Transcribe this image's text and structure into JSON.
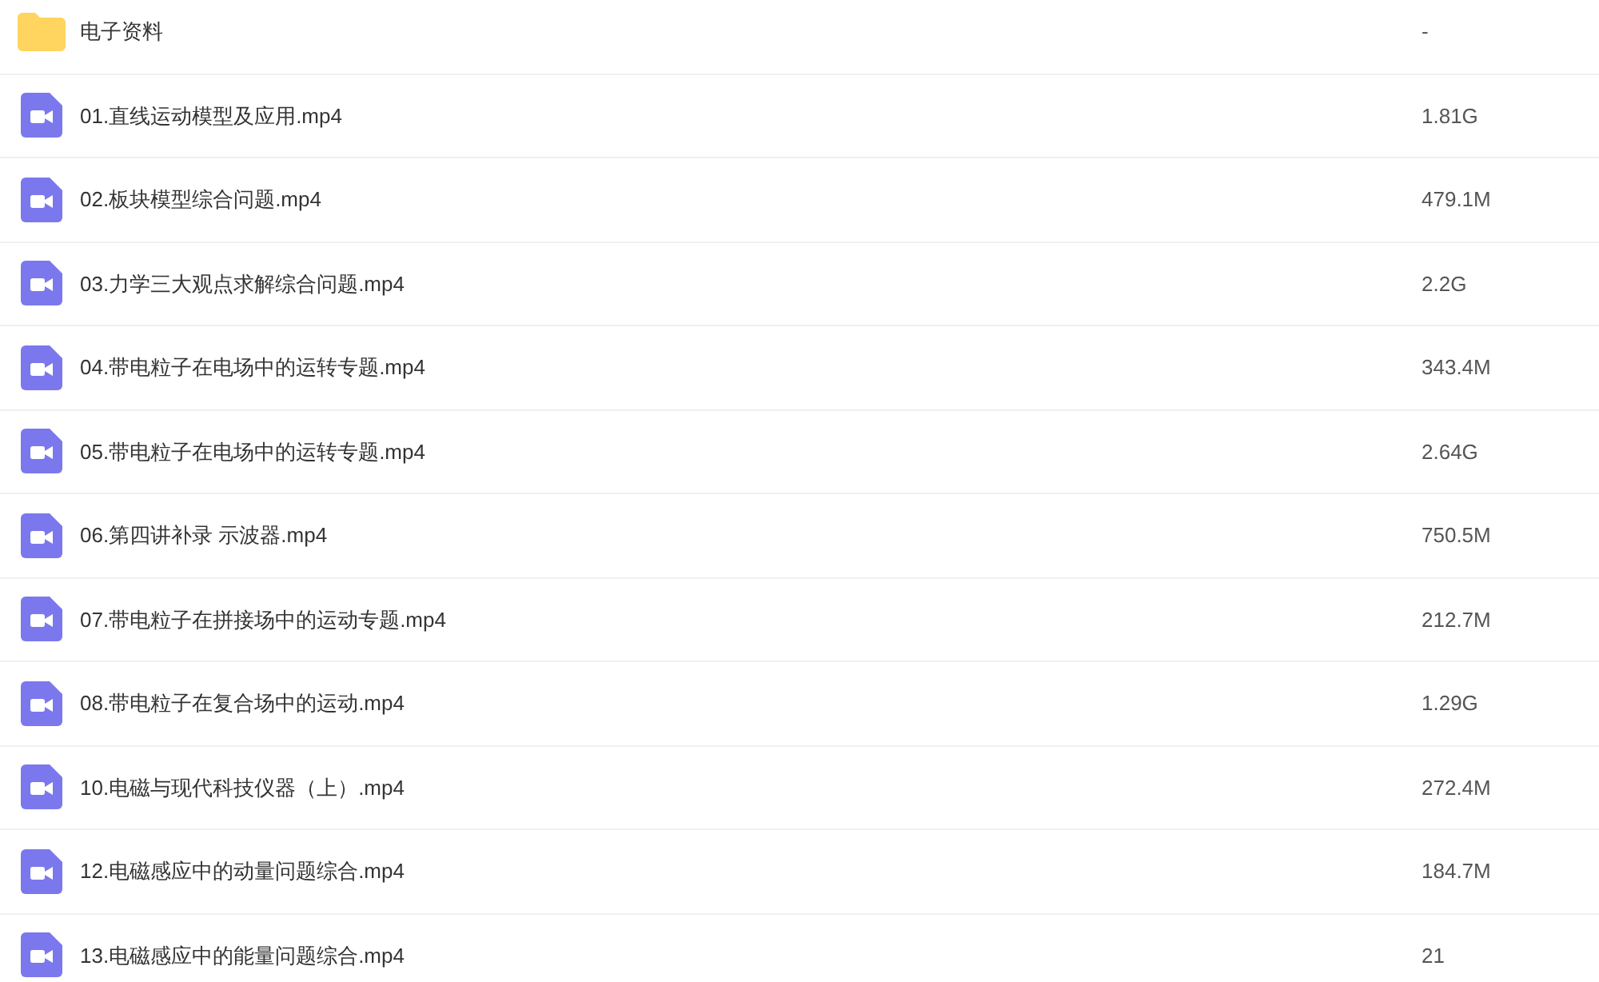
{
  "files": [
    {
      "kind": "folder",
      "name": "电子资料",
      "size": "-"
    },
    {
      "kind": "video",
      "name": "01.直线运动模型及应用.mp4",
      "size": "1.81G"
    },
    {
      "kind": "video",
      "name": "02.板块模型综合问题.mp4",
      "size": "479.1M"
    },
    {
      "kind": "video",
      "name": "03.力学三大观点求解综合问题.mp4",
      "size": "2.2G"
    },
    {
      "kind": "video",
      "name": "04.带电粒子在电场中的运转专题.mp4",
      "size": "343.4M"
    },
    {
      "kind": "video",
      "name": "05.带电粒子在电场中的运转专题.mp4",
      "size": "2.64G"
    },
    {
      "kind": "video",
      "name": "06.第四讲补录 示波器.mp4",
      "size": "750.5M"
    },
    {
      "kind": "video",
      "name": "07.带电粒子在拼接场中的运动专题.mp4",
      "size": "212.7M"
    },
    {
      "kind": "video",
      "name": "08.带电粒子在复合场中的运动.mp4",
      "size": "1.29G"
    },
    {
      "kind": "video",
      "name": "10.电磁与现代科技仪器（上）.mp4",
      "size": "272.4M"
    },
    {
      "kind": "video",
      "name": "12.电磁感应中的动量问题综合.mp4",
      "size": "184.7M"
    },
    {
      "kind": "video",
      "name": "13.电磁感应中的能量问题综合.mp4",
      "size": "21"
    }
  ]
}
